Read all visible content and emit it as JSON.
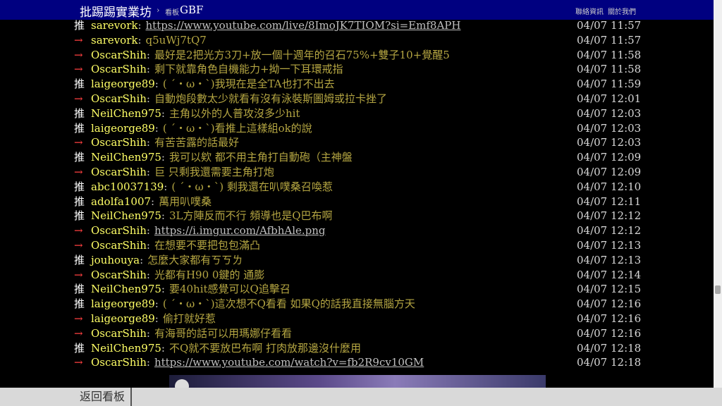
{
  "topbar": {
    "board_name": "批踢踢實業坊",
    "separator": "›",
    "crumb_label": "看板",
    "crumb_board": "GBF",
    "links": [
      "聯絡資訊",
      "關於我們"
    ]
  },
  "pushes": [
    {
      "tag": "推",
      "user": "sarevork",
      "content": "https://www.youtube.com/live/8ImoJK7TIOM?si=Emf8APH",
      "is_link": true,
      "time": "04/07 11:57"
    },
    {
      "tag": "→",
      "user": "sarevork",
      "content": "q5uWj7tQ7",
      "is_link": false,
      "time": "04/07 11:57"
    },
    {
      "tag": "→",
      "user": "OscarShih",
      "content": "最好是2把光方3刀+放一個十週年的召石75%+雙子10+覺醒5",
      "is_link": false,
      "time": "04/07 11:58"
    },
    {
      "tag": "→",
      "user": "OscarShih",
      "content": "剩下就靠角色自機能力+拗一下耳環戒指",
      "is_link": false,
      "time": "04/07 11:58"
    },
    {
      "tag": "推",
      "user": "laigeorge89",
      "content": "( ´・ω・`)我現在是全TA也打不出去",
      "is_link": false,
      "time": "04/07 11:59"
    },
    {
      "tag": "→",
      "user": "OscarShih",
      "content": "自動炮段數太少就看有沒有泳裝斯圖姆或拉卡挫了",
      "is_link": false,
      "time": "04/07 12:01"
    },
    {
      "tag": "推",
      "user": "NeilChen975",
      "content": "主角以外的人普攻沒多少hit",
      "is_link": false,
      "time": "04/07 12:03"
    },
    {
      "tag": "推",
      "user": "laigeorge89",
      "content": "( ´・ω・`)看推上這樣組ok的說",
      "is_link": false,
      "time": "04/07 12:03"
    },
    {
      "tag": "→",
      "user": "OscarShih",
      "content": "有苦苦露的話最好",
      "is_link": false,
      "time": "04/07 12:03"
    },
    {
      "tag": "推",
      "user": "NeilChen975",
      "content": "我可以欸 都不用主角打自動砲（主神盤",
      "is_link": false,
      "time": "04/07 12:09"
    },
    {
      "tag": "→",
      "user": "OscarShih",
      "content": "巨 只剩我還需要主角打炮",
      "is_link": false,
      "time": "04/07 12:09"
    },
    {
      "tag": "推",
      "user": "abc10037139",
      "content": "( ´・ω・`) 剩我還在叭噗桑召喚惹",
      "is_link": false,
      "time": "04/07 12:10"
    },
    {
      "tag": "推",
      "user": "adolfa1007",
      "content": "萬用叭噗桑",
      "is_link": false,
      "time": "04/07 12:11"
    },
    {
      "tag": "推",
      "user": "NeilChen975",
      "content": "3L方陣反而不行 頻導也是Q巴布啊",
      "is_link": false,
      "time": "04/07 12:12"
    },
    {
      "tag": "→",
      "user": "OscarShih",
      "content": "https://i.imgur.com/AfbhAle.png",
      "is_link": true,
      "time": "04/07 12:12"
    },
    {
      "tag": "→",
      "user": "OscarShih",
      "content": "在想要不要把包包滿凸",
      "is_link": false,
      "time": "04/07 12:13"
    },
    {
      "tag": "推",
      "user": "jouhouya",
      "content": "怎麼大家都有ㄎㄎㄌ",
      "is_link": false,
      "time": "04/07 12:13"
    },
    {
      "tag": "→",
      "user": "OscarShih",
      "content": "光都有H90 0鍵的 通膨",
      "is_link": false,
      "time": "04/07 12:14"
    },
    {
      "tag": "推",
      "user": "NeilChen975",
      "content": "要40hit感覺可以Q追擊召",
      "is_link": false,
      "time": "04/07 12:15"
    },
    {
      "tag": "推",
      "user": "laigeorge89",
      "content": "( ´・ω・`)這次想不Q看看 如果Q的話我直接無腦方天",
      "is_link": false,
      "time": "04/07 12:16"
    },
    {
      "tag": "→",
      "user": "laigeorge89",
      "content": "偷打就好惹",
      "is_link": false,
      "time": "04/07 12:16"
    },
    {
      "tag": "→",
      "user": "OscarShih",
      "content": "有海哥的話可以用瑪娜仔看看",
      "is_link": false,
      "time": "04/07 12:16"
    },
    {
      "tag": "推",
      "user": "NeilChen975",
      "content": "不Q就不要放巴布啊 打肉放那邊沒什麼用",
      "is_link": false,
      "time": "04/07 12:18"
    },
    {
      "tag": "→",
      "user": "OscarShih",
      "content": "https://www.youtube.com/watch?v=fb2R9cv10GM",
      "is_link": true,
      "time": "04/07 12:18"
    }
  ],
  "bottombar": {
    "back_label": "返回看板"
  }
}
